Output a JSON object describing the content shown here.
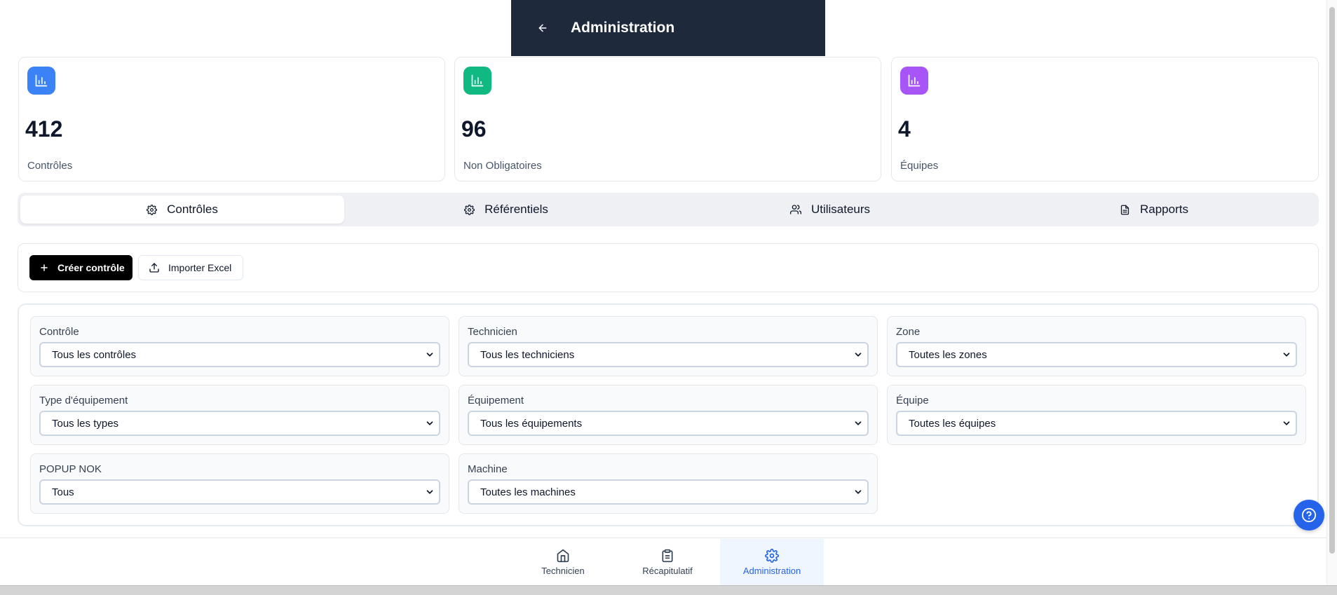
{
  "header": {
    "title": "Administration"
  },
  "stats": [
    {
      "value": "412",
      "label": "Contrôles",
      "color": "#3b82f6"
    },
    {
      "value": "96",
      "label": "Non Obligatoires",
      "color": "#10b981"
    },
    {
      "value": "4",
      "label": "Équipes",
      "color": "#a855f7"
    }
  ],
  "tabs": [
    {
      "label": "Contrôles",
      "icon": "gear-icon",
      "active": true
    },
    {
      "label": "Référentiels",
      "icon": "gear-icon",
      "active": false
    },
    {
      "label": "Utilisateurs",
      "icon": "users-icon",
      "active": false
    },
    {
      "label": "Rapports",
      "icon": "file-text-icon",
      "active": false
    }
  ],
  "toolbar": {
    "create_label": "Créer contrôle",
    "import_label": "Importer Excel"
  },
  "filters": [
    {
      "label": "Contrôle",
      "value": "Tous les contrôles"
    },
    {
      "label": "Technicien",
      "value": "Tous les techniciens"
    },
    {
      "label": "Zone",
      "value": "Toutes les zones"
    },
    {
      "label": "Type d'équipement",
      "value": "Tous les types"
    },
    {
      "label": "Équipement",
      "value": "Tous les équipements"
    },
    {
      "label": "Équipe",
      "value": "Toutes les équipes"
    },
    {
      "label": "POPUP NOK",
      "value": "Tous"
    },
    {
      "label": "Machine",
      "value": "Toutes les machines"
    }
  ],
  "bottom_nav": [
    {
      "label": "Technicien",
      "icon": "home-icon"
    },
    {
      "label": "Récapitulatif",
      "icon": "clipboard-icon"
    },
    {
      "label": "Administration",
      "icon": "gear-icon",
      "active": true
    }
  ],
  "colors": {
    "header_bg": "#1e293b",
    "accent": "#2563eb",
    "primary_button": "#000000"
  }
}
